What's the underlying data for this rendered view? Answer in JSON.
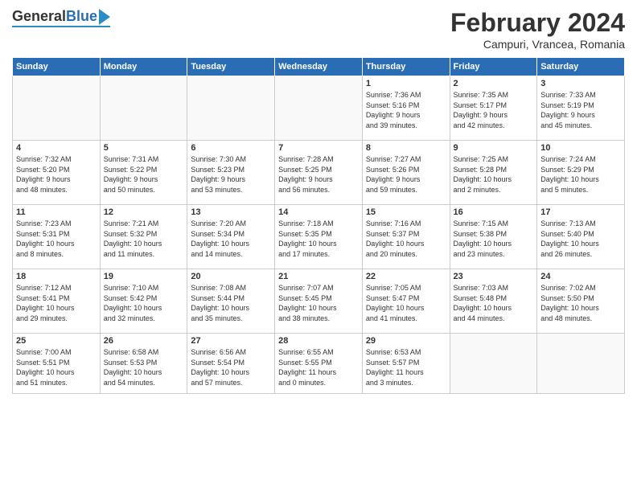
{
  "logo": {
    "general": "General",
    "blue": "Blue"
  },
  "title": "February 2024",
  "subtitle": "Campuri, Vrancea, Romania",
  "headers": [
    "Sunday",
    "Monday",
    "Tuesday",
    "Wednesday",
    "Thursday",
    "Friday",
    "Saturday"
  ],
  "weeks": [
    [
      {
        "day": "",
        "info": ""
      },
      {
        "day": "",
        "info": ""
      },
      {
        "day": "",
        "info": ""
      },
      {
        "day": "",
        "info": ""
      },
      {
        "day": "1",
        "info": "Sunrise: 7:36 AM\nSunset: 5:16 PM\nDaylight: 9 hours\nand 39 minutes."
      },
      {
        "day": "2",
        "info": "Sunrise: 7:35 AM\nSunset: 5:17 PM\nDaylight: 9 hours\nand 42 minutes."
      },
      {
        "day": "3",
        "info": "Sunrise: 7:33 AM\nSunset: 5:19 PM\nDaylight: 9 hours\nand 45 minutes."
      }
    ],
    [
      {
        "day": "4",
        "info": "Sunrise: 7:32 AM\nSunset: 5:20 PM\nDaylight: 9 hours\nand 48 minutes."
      },
      {
        "day": "5",
        "info": "Sunrise: 7:31 AM\nSunset: 5:22 PM\nDaylight: 9 hours\nand 50 minutes."
      },
      {
        "day": "6",
        "info": "Sunrise: 7:30 AM\nSunset: 5:23 PM\nDaylight: 9 hours\nand 53 minutes."
      },
      {
        "day": "7",
        "info": "Sunrise: 7:28 AM\nSunset: 5:25 PM\nDaylight: 9 hours\nand 56 minutes."
      },
      {
        "day": "8",
        "info": "Sunrise: 7:27 AM\nSunset: 5:26 PM\nDaylight: 9 hours\nand 59 minutes."
      },
      {
        "day": "9",
        "info": "Sunrise: 7:25 AM\nSunset: 5:28 PM\nDaylight: 10 hours\nand 2 minutes."
      },
      {
        "day": "10",
        "info": "Sunrise: 7:24 AM\nSunset: 5:29 PM\nDaylight: 10 hours\nand 5 minutes."
      }
    ],
    [
      {
        "day": "11",
        "info": "Sunrise: 7:23 AM\nSunset: 5:31 PM\nDaylight: 10 hours\nand 8 minutes."
      },
      {
        "day": "12",
        "info": "Sunrise: 7:21 AM\nSunset: 5:32 PM\nDaylight: 10 hours\nand 11 minutes."
      },
      {
        "day": "13",
        "info": "Sunrise: 7:20 AM\nSunset: 5:34 PM\nDaylight: 10 hours\nand 14 minutes."
      },
      {
        "day": "14",
        "info": "Sunrise: 7:18 AM\nSunset: 5:35 PM\nDaylight: 10 hours\nand 17 minutes."
      },
      {
        "day": "15",
        "info": "Sunrise: 7:16 AM\nSunset: 5:37 PM\nDaylight: 10 hours\nand 20 minutes."
      },
      {
        "day": "16",
        "info": "Sunrise: 7:15 AM\nSunset: 5:38 PM\nDaylight: 10 hours\nand 23 minutes."
      },
      {
        "day": "17",
        "info": "Sunrise: 7:13 AM\nSunset: 5:40 PM\nDaylight: 10 hours\nand 26 minutes."
      }
    ],
    [
      {
        "day": "18",
        "info": "Sunrise: 7:12 AM\nSunset: 5:41 PM\nDaylight: 10 hours\nand 29 minutes."
      },
      {
        "day": "19",
        "info": "Sunrise: 7:10 AM\nSunset: 5:42 PM\nDaylight: 10 hours\nand 32 minutes."
      },
      {
        "day": "20",
        "info": "Sunrise: 7:08 AM\nSunset: 5:44 PM\nDaylight: 10 hours\nand 35 minutes."
      },
      {
        "day": "21",
        "info": "Sunrise: 7:07 AM\nSunset: 5:45 PM\nDaylight: 10 hours\nand 38 minutes."
      },
      {
        "day": "22",
        "info": "Sunrise: 7:05 AM\nSunset: 5:47 PM\nDaylight: 10 hours\nand 41 minutes."
      },
      {
        "day": "23",
        "info": "Sunrise: 7:03 AM\nSunset: 5:48 PM\nDaylight: 10 hours\nand 44 minutes."
      },
      {
        "day": "24",
        "info": "Sunrise: 7:02 AM\nSunset: 5:50 PM\nDaylight: 10 hours\nand 48 minutes."
      }
    ],
    [
      {
        "day": "25",
        "info": "Sunrise: 7:00 AM\nSunset: 5:51 PM\nDaylight: 10 hours\nand 51 minutes."
      },
      {
        "day": "26",
        "info": "Sunrise: 6:58 AM\nSunset: 5:53 PM\nDaylight: 10 hours\nand 54 minutes."
      },
      {
        "day": "27",
        "info": "Sunrise: 6:56 AM\nSunset: 5:54 PM\nDaylight: 10 hours\nand 57 minutes."
      },
      {
        "day": "28",
        "info": "Sunrise: 6:55 AM\nSunset: 5:55 PM\nDaylight: 11 hours\nand 0 minutes."
      },
      {
        "day": "29",
        "info": "Sunrise: 6:53 AM\nSunset: 5:57 PM\nDaylight: 11 hours\nand 3 minutes."
      },
      {
        "day": "",
        "info": ""
      },
      {
        "day": "",
        "info": ""
      }
    ]
  ]
}
